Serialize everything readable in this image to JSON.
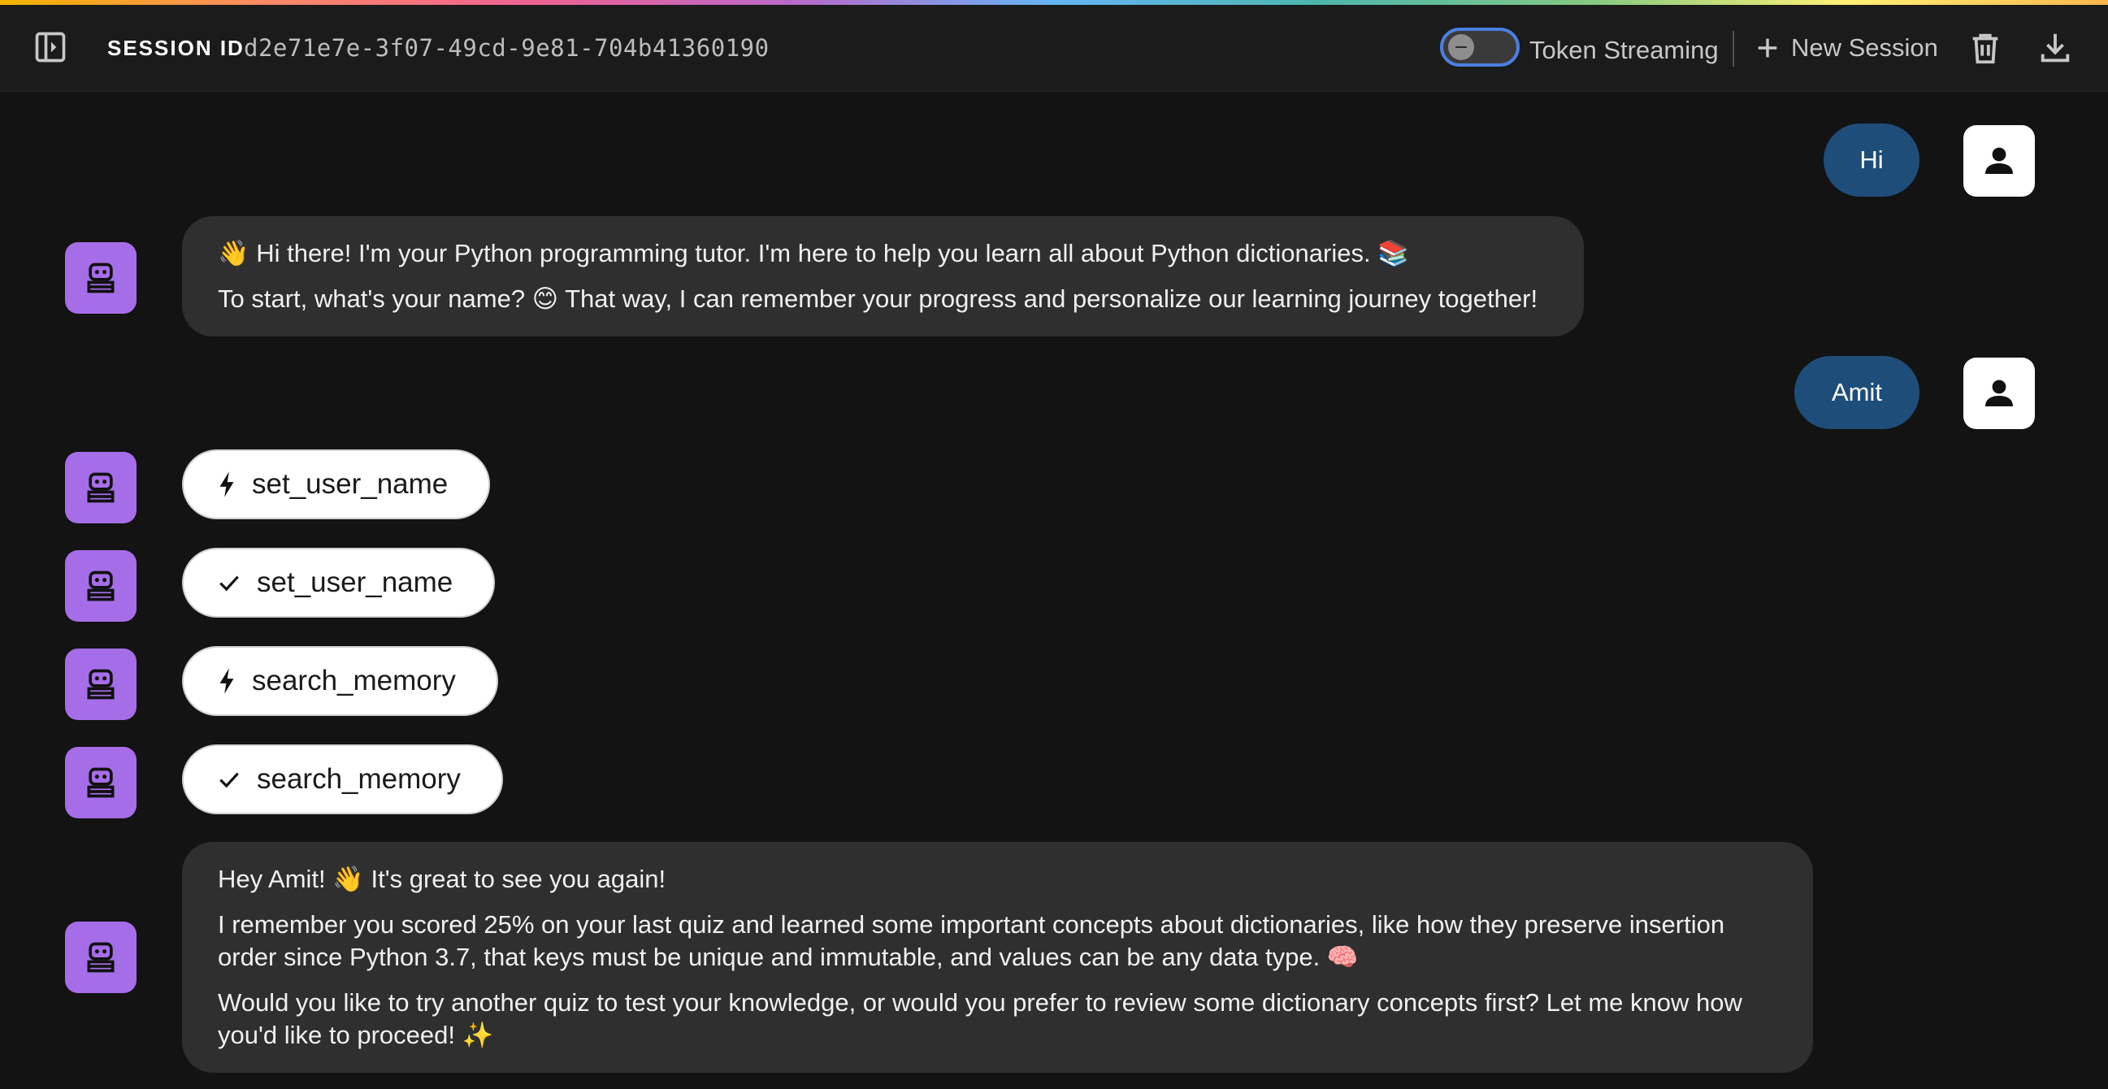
{
  "header": {
    "session_label": "SESSION ID",
    "session_id": "d2e71e7e-3f07-49cd-9e81-704b41360190",
    "token_streaming_label": "Token Streaming",
    "token_streaming_on": false,
    "new_session_label": "New Session"
  },
  "messages": [
    {
      "role": "user",
      "text": "Hi"
    },
    {
      "role": "bot",
      "paragraphs": [
        "👋 Hi there! I'm your Python programming tutor. I'm here to help you learn all about Python dictionaries. 📚",
        "To start, what's your name? 😊 That way, I can remember your progress and personalize our learning journey together!"
      ]
    },
    {
      "role": "user",
      "text": "Amit"
    },
    {
      "role": "tool",
      "status": "call",
      "icon": "bolt-icon",
      "name": "set_user_name"
    },
    {
      "role": "tool",
      "status": "done",
      "icon": "check-icon",
      "name": "set_user_name"
    },
    {
      "role": "tool",
      "status": "call",
      "icon": "bolt-icon",
      "name": "search_memory"
    },
    {
      "role": "tool",
      "status": "done",
      "icon": "check-icon",
      "name": "search_memory"
    },
    {
      "role": "bot",
      "paragraphs": [
        "Hey Amit! 👋 It's great to see you again!",
        "I remember you scored 25% on your last quiz and learned some important concepts about dictionaries, like how they preserve insertion order since Python 3.7, that keys must be unique and immutable, and values can be any data type. 🧠",
        "Would you like to try another quiz to test your knowledge, or would you prefer to review some dictionary concepts first? Let me know how you'd like to proceed! ✨"
      ]
    }
  ],
  "colors": {
    "user_bubble": "#1f4d7a",
    "bot_avatar": "#a66de8",
    "bot_bubble": "#2f2f2f",
    "toggle_border": "#4a7fe0"
  }
}
